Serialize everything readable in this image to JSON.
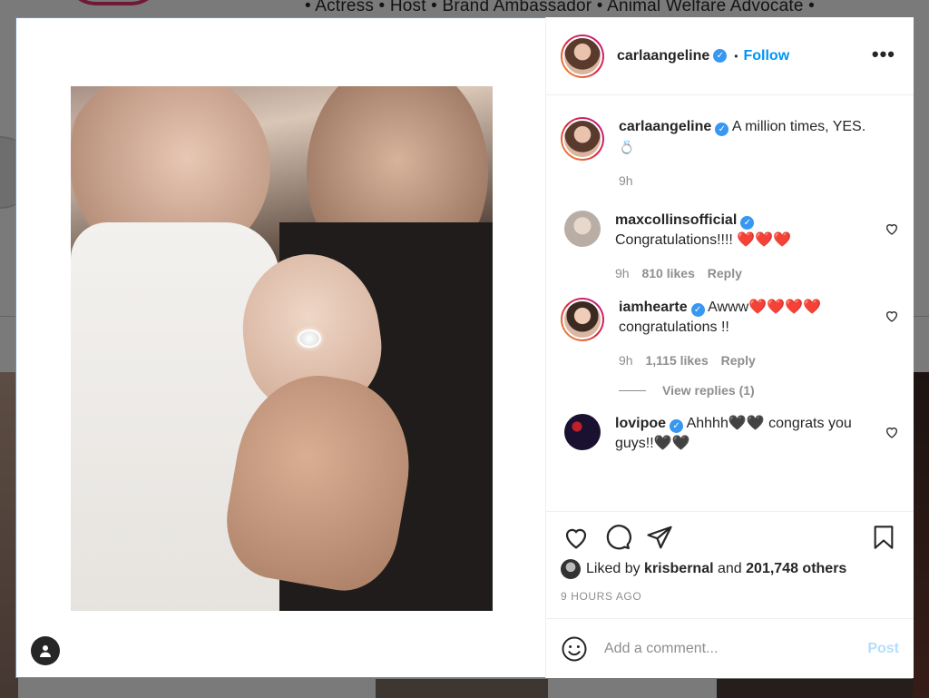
{
  "background": {
    "tagline": "• Actress • Host • Brand Ambassador • Animal Welfare Advocate •"
  },
  "post": {
    "author": "carlaangeline",
    "follow_label": "Follow",
    "more_label": "•••",
    "caption": {
      "username": "carlaangeline",
      "text": "A million times, YES.",
      "emoji": "💍",
      "time": "9h"
    },
    "comments": [
      {
        "username": "maxcollinsofficial",
        "text": "Congratulations!!!! ❤️❤️❤️",
        "time": "9h",
        "likes": "810 likes",
        "reply_label": "Reply",
        "avatar_color": "#cfcac4"
      },
      {
        "username": "iamhearte",
        "text": "Awww❤️❤️❤️❤️ congratulations !!",
        "time": "9h",
        "likes": "1,115 likes",
        "reply_label": "Reply",
        "avatar_color": "#d6b3a0",
        "view_replies": "View replies (1)"
      },
      {
        "username": "lovipoe",
        "text": "Ahhhh🖤🖤 congrats you guys!!🖤🖤",
        "avatar_color": "#2a1a3a"
      }
    ],
    "liked_by": {
      "prefix": "Liked by",
      "user": "krisbernal",
      "joiner": "and",
      "others": "201,748 others"
    },
    "time_ago": "9 HOURS AGO",
    "add_comment_placeholder": "Add a comment...",
    "post_label": "Post"
  },
  "colors": {
    "accent": "#0095f6",
    "verified": "#3897f0",
    "post_disabled": "#b2dffc"
  },
  "icons": [
    "user-tag-icon",
    "verified-icon",
    "more-options-icon",
    "heart-icon",
    "comment-icon",
    "share-icon",
    "bookmark-icon",
    "emoji-icon"
  ]
}
